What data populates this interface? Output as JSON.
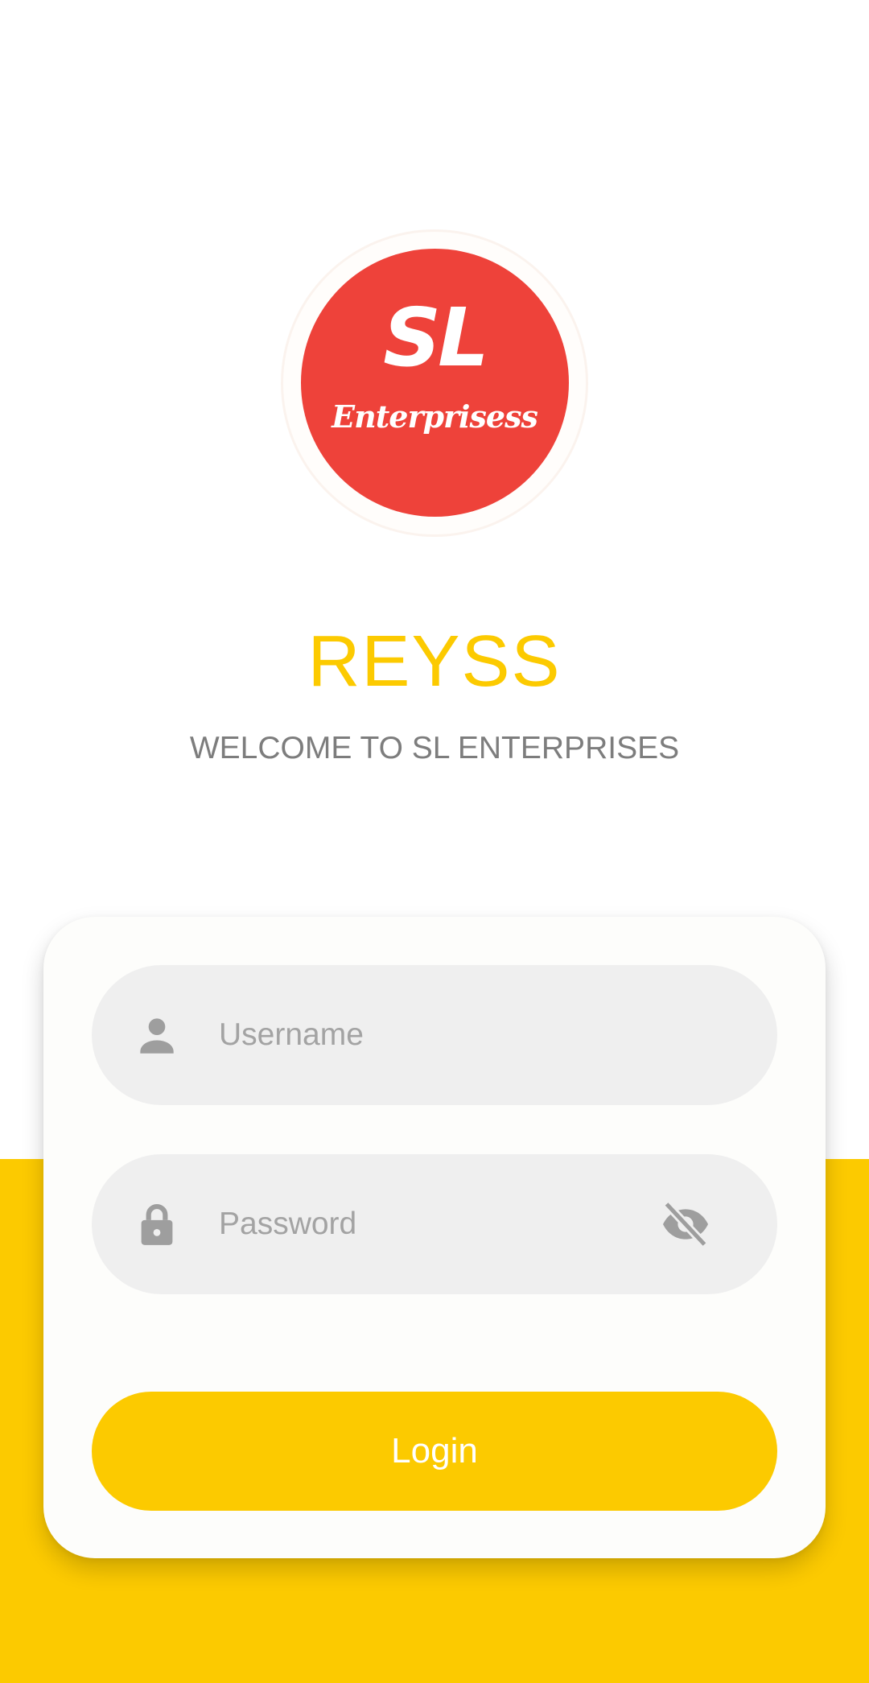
{
  "logo": {
    "monogram": "SL",
    "wordmark": "Enterprisess",
    "circle_color": "#EE423A",
    "icon": "brand-logo"
  },
  "app_title": "REYSS",
  "welcome_text": "WELCOME TO SL ENTERPRISES",
  "login_form": {
    "username": {
      "placeholder": "Username",
      "value": "",
      "icon": "person-icon"
    },
    "password": {
      "placeholder": "Password",
      "value": "",
      "icon": "lock-icon",
      "visibility_icon": "eye-off-icon"
    },
    "submit_label": "Login"
  },
  "colors": {
    "accent": "#FCCA00",
    "brand_red": "#EE423A",
    "field_bg": "#EFEFEF",
    "placeholder_text": "#A3A3A3",
    "subtitle_text": "#7D7D7D"
  }
}
